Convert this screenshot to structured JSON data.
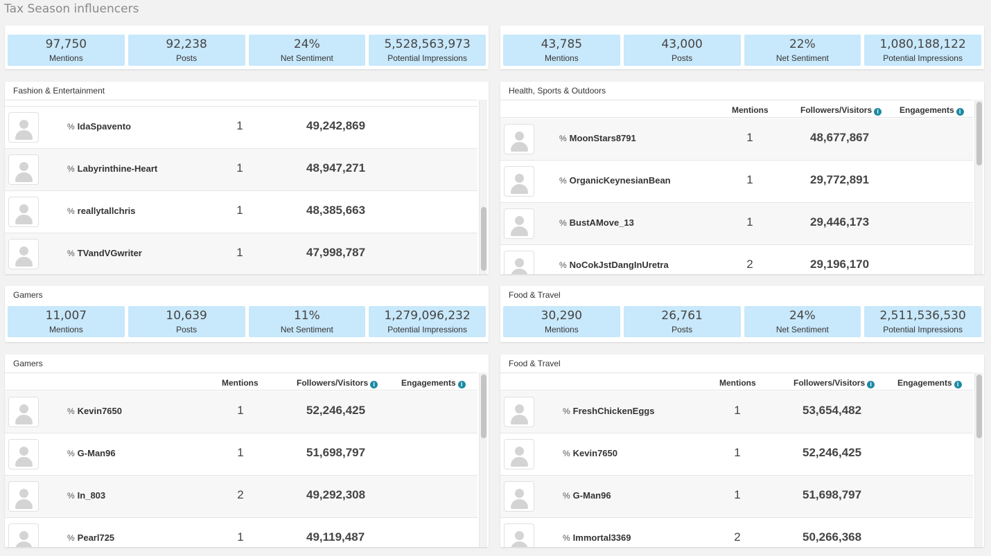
{
  "page_title": "Tax Season influencers",
  "columns": {
    "mentions": "Mentions",
    "followers": "Followers/Visitors",
    "engagements": "Engagements"
  },
  "top_left_metrics": [
    {
      "value": "97,750",
      "label": "Mentions"
    },
    {
      "value": "92,238",
      "label": "Posts"
    },
    {
      "value": "24%",
      "label": "Net Sentiment"
    },
    {
      "value": "5,528,563,973",
      "label": "Potential Impressions"
    }
  ],
  "top_right_metrics": [
    {
      "value": "43,785",
      "label": "Mentions"
    },
    {
      "value": "43,000",
      "label": "Posts"
    },
    {
      "value": "22%",
      "label": "Net Sentiment"
    },
    {
      "value": "1,080,188,122",
      "label": "Potential Impressions"
    }
  ],
  "fashion": {
    "title": "Fashion & Entertainment",
    "rows": [
      {
        "name": "IdaSpavento",
        "mentions": "1",
        "followers": "49,242,869"
      },
      {
        "name": "Labyrinthine-Heart",
        "mentions": "1",
        "followers": "48,947,271"
      },
      {
        "name": "reallytallchris",
        "mentions": "1",
        "followers": "48,385,663"
      },
      {
        "name": "TVandVGwriter",
        "mentions": "1",
        "followers": "47,998,787"
      }
    ]
  },
  "health": {
    "title": "Health, Sports & Outdoors",
    "rows": [
      {
        "name": "MoonStars8791",
        "mentions": "1",
        "followers": "48,677,867"
      },
      {
        "name": "OrganicKeynesianBean",
        "mentions": "1",
        "followers": "29,772,891"
      },
      {
        "name": "BustAMove_13",
        "mentions": "1",
        "followers": "29,446,173"
      },
      {
        "name": "NoCokJstDangInUretra",
        "mentions": "2",
        "followers": "29,196,170"
      }
    ]
  },
  "gamers_summary": {
    "title": "Gamers",
    "metrics": [
      {
        "value": "11,007",
        "label": "Mentions"
      },
      {
        "value": "10,639",
        "label": "Posts"
      },
      {
        "value": "11%",
        "label": "Net Sentiment"
      },
      {
        "value": "1,279,096,232",
        "label": "Potential Impressions"
      }
    ]
  },
  "food_summary": {
    "title": "Food & Travel",
    "metrics": [
      {
        "value": "30,290",
        "label": "Mentions"
      },
      {
        "value": "26,761",
        "label": "Posts"
      },
      {
        "value": "24%",
        "label": "Net Sentiment"
      },
      {
        "value": "2,511,536,530",
        "label": "Potential Impressions"
      }
    ]
  },
  "gamers": {
    "title": "Gamers",
    "rows": [
      {
        "name": "Kevin7650",
        "mentions": "1",
        "followers": "52,246,425"
      },
      {
        "name": "G-Man96",
        "mentions": "1",
        "followers": "51,698,797"
      },
      {
        "name": "In_803",
        "mentions": "2",
        "followers": "49,292,308"
      },
      {
        "name": "Pearl725",
        "mentions": "1",
        "followers": "49,119,487"
      }
    ]
  },
  "food": {
    "title": "Food & Travel",
    "rows": [
      {
        "name": "FreshChickenEggs",
        "mentions": "1",
        "followers": "53,654,482"
      },
      {
        "name": "Kevin7650",
        "mentions": "1",
        "followers": "52,246,425"
      },
      {
        "name": "G-Man96",
        "mentions": "1",
        "followers": "51,698,797"
      },
      {
        "name": "Immortal3369",
        "mentions": "2",
        "followers": "50,266,368"
      }
    ]
  },
  "icons": {
    "link": "link-icon",
    "info": "info-icon",
    "avatar": "avatar-placeholder"
  },
  "colors": {
    "metric_bg": "#c8e8fb",
    "info_icon": "#1c8aa3"
  }
}
